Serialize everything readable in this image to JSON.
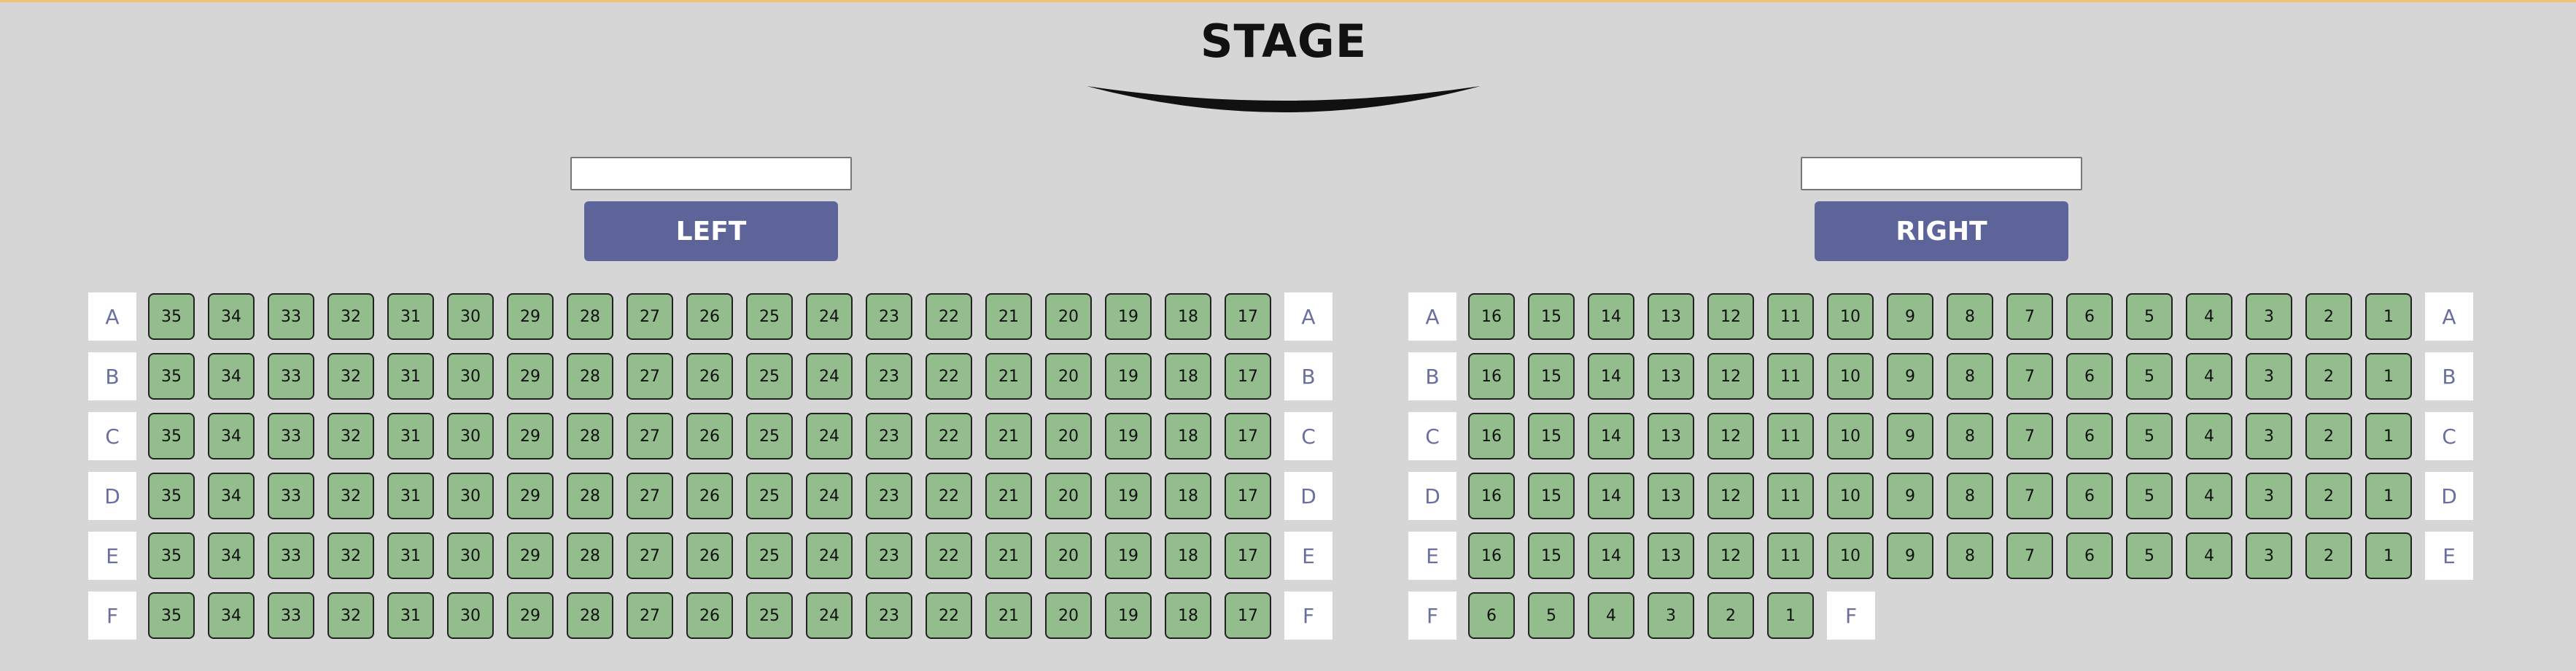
{
  "stage": {
    "title": "STAGE"
  },
  "left": {
    "input_value": "",
    "button_label": "LEFT",
    "rows": [
      {
        "label": "A",
        "seats": [
          "35",
          "34",
          "33",
          "32",
          "31",
          "30",
          "29",
          "28",
          "27",
          "26",
          "25",
          "24",
          "23",
          "22",
          "21",
          "20",
          "19",
          "18",
          "17"
        ]
      },
      {
        "label": "B",
        "seats": [
          "35",
          "34",
          "33",
          "32",
          "31",
          "30",
          "29",
          "28",
          "27",
          "26",
          "25",
          "24",
          "23",
          "22",
          "21",
          "20",
          "19",
          "18",
          "17"
        ]
      },
      {
        "label": "C",
        "seats": [
          "35",
          "34",
          "33",
          "32",
          "31",
          "30",
          "29",
          "28",
          "27",
          "26",
          "25",
          "24",
          "23",
          "22",
          "21",
          "20",
          "19",
          "18",
          "17"
        ]
      },
      {
        "label": "D",
        "seats": [
          "35",
          "34",
          "33",
          "32",
          "31",
          "30",
          "29",
          "28",
          "27",
          "26",
          "25",
          "24",
          "23",
          "22",
          "21",
          "20",
          "19",
          "18",
          "17"
        ]
      },
      {
        "label": "E",
        "seats": [
          "35",
          "34",
          "33",
          "32",
          "31",
          "30",
          "29",
          "28",
          "27",
          "26",
          "25",
          "24",
          "23",
          "22",
          "21",
          "20",
          "19",
          "18",
          "17"
        ]
      },
      {
        "label": "F",
        "seats": [
          "35",
          "34",
          "33",
          "32",
          "31",
          "30",
          "29",
          "28",
          "27",
          "26",
          "25",
          "24",
          "23",
          "22",
          "21",
          "20",
          "19",
          "18",
          "17"
        ]
      }
    ]
  },
  "right": {
    "input_value": "",
    "button_label": "RIGHT",
    "rows": [
      {
        "label": "A",
        "seats": [
          "16",
          "15",
          "14",
          "13",
          "12",
          "11",
          "10",
          "9",
          "8",
          "7",
          "6",
          "5",
          "4",
          "3",
          "2",
          "1"
        ]
      },
      {
        "label": "B",
        "seats": [
          "16",
          "15",
          "14",
          "13",
          "12",
          "11",
          "10",
          "9",
          "8",
          "7",
          "6",
          "5",
          "4",
          "3",
          "2",
          "1"
        ]
      },
      {
        "label": "C",
        "seats": [
          "16",
          "15",
          "14",
          "13",
          "12",
          "11",
          "10",
          "9",
          "8",
          "7",
          "6",
          "5",
          "4",
          "3",
          "2",
          "1"
        ]
      },
      {
        "label": "D",
        "seats": [
          "16",
          "15",
          "14",
          "13",
          "12",
          "11",
          "10",
          "9",
          "8",
          "7",
          "6",
          "5",
          "4",
          "3",
          "2",
          "1"
        ]
      },
      {
        "label": "E",
        "seats": [
          "16",
          "15",
          "14",
          "13",
          "12",
          "11",
          "10",
          "9",
          "8",
          "7",
          "6",
          "5",
          "4",
          "3",
          "2",
          "1"
        ]
      },
      {
        "label": "F",
        "seats": [
          "6",
          "5",
          "4",
          "3",
          "2",
          "1"
        ]
      }
    ]
  },
  "colors": {
    "background": "#d6d6d6",
    "seat_available": "#94bd8d",
    "section_button": "#5d6499",
    "row_label_text": "#6a6fa0",
    "top_accent": "#f0c36d"
  }
}
